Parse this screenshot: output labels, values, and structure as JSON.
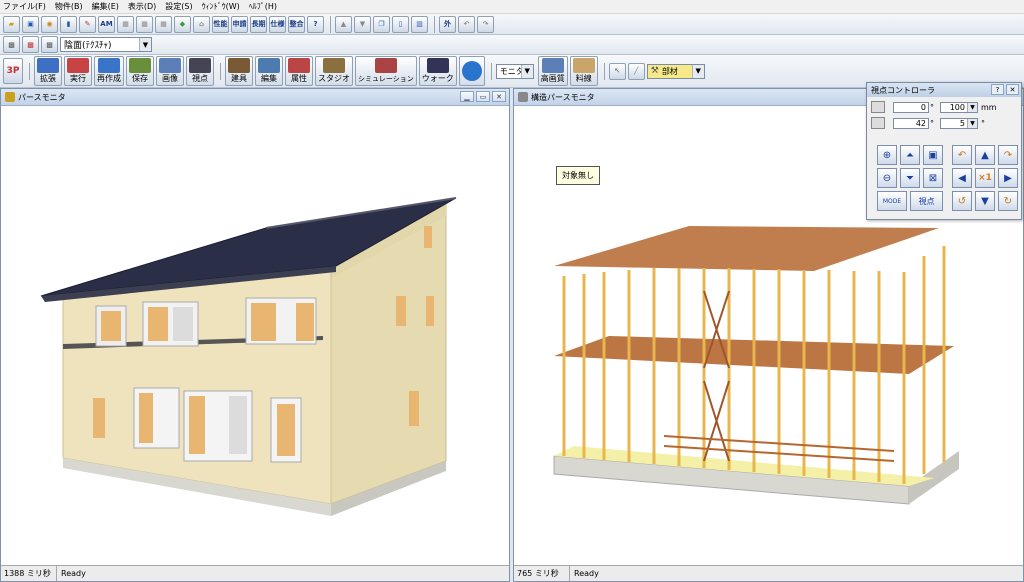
{
  "menu": [
    "ファイル(F)",
    "物件(B)",
    "編集(E)",
    "表示(D)",
    "設定(S)",
    "ｳｨﾝﾄﾞｳ(W)",
    "ﾍﾙﾌﾟ(H)"
  ],
  "toolbar1": {
    "icons": [
      "open-icon",
      "save-icon",
      "view-icon",
      "info-icon",
      "edit-icon",
      "am-icon",
      "grid-icon",
      "grid2-icon",
      "grid3-icon",
      "beginner-icon",
      "house-icon",
      "performance-icon",
      "apply-icon",
      "structure-icon",
      "spec-icon",
      "evaluate-icon",
      "help-icon",
      "up-icon",
      "down-icon",
      "copy-icon",
      "window-icon",
      "tile-icon",
      "outside-icon",
      "undo-icon",
      "redo-icon"
    ],
    "labels": {
      "am": "AM",
      "outside": "外",
      "perf1": "性能",
      "perf2": "申請",
      "perf3": "長期",
      "perf4": "仕様",
      "perf5": "整合"
    }
  },
  "toolbar2": {
    "display_mode": "陰面(ﾃｸｽﾁｬ)"
  },
  "toolbar3": {
    "badge": "3P",
    "buttons": [
      {
        "label": "拡張",
        "icon": "extend-icon",
        "color": "#3f6fc4"
      },
      {
        "label": "実行",
        "icon": "run-icon",
        "color": "#c84444"
      },
      {
        "label": "再作成",
        "icon": "recreate-icon",
        "color": "#3a74c9"
      },
      {
        "label": "保存",
        "icon": "save-house-icon",
        "color": "#6a8f3c"
      },
      {
        "label": "画像",
        "icon": "image-icon",
        "color": "#5d7fb8"
      },
      {
        "label": "視点",
        "icon": "viewpoint-icon",
        "color": "#334"
      },
      {
        "label": "建具",
        "icon": "fitting-icon",
        "color": "#7a5a35"
      },
      {
        "label": "編集",
        "icon": "edit-pencil-icon",
        "color": "#4f7ab0"
      },
      {
        "label": "属性",
        "icon": "attribute-icon",
        "color": "#b44"
      },
      {
        "label": "スタジオ",
        "icon": "studio-icon",
        "color": "#8b6f3f"
      },
      {
        "label": "シミュレーション",
        "icon": "simulation-icon",
        "color": "#a44"
      },
      {
        "label": "ウォーク",
        "icon": "walk-icon",
        "color": "#335"
      },
      {
        "label": "",
        "icon": "rotate-globe-icon",
        "color": "#2a74cc"
      }
    ],
    "monitor_combo": "モニタ",
    "high_quality_label": "高画質",
    "material_label": "料線",
    "member_label": "部材"
  },
  "left_window": {
    "title": "パースモニタ",
    "status_time": "1388 ミリ秒",
    "status_text": "Ready"
  },
  "right_window": {
    "title": "構造パースモニタ",
    "tooltip": "対象無し",
    "status_time": "765 ミリ秒",
    "status_text": "Ready"
  },
  "view_controller": {
    "title": "視点コントローラ",
    "help": "?",
    "angle1": "0",
    "angle2": "42",
    "degree": "°",
    "distance": "100",
    "distance_unit": "mm",
    "step_angle": "5",
    "step_unit": "°",
    "zoom_label": "×1",
    "viewpoint_label": "視点",
    "mode_label": "MODE"
  },
  "colors": {
    "roof": "#2b2e47",
    "wall": "#efe3bd",
    "timber": "#e8b64c",
    "beam": "#b5672f",
    "foundation": "#d8d8d0"
  }
}
